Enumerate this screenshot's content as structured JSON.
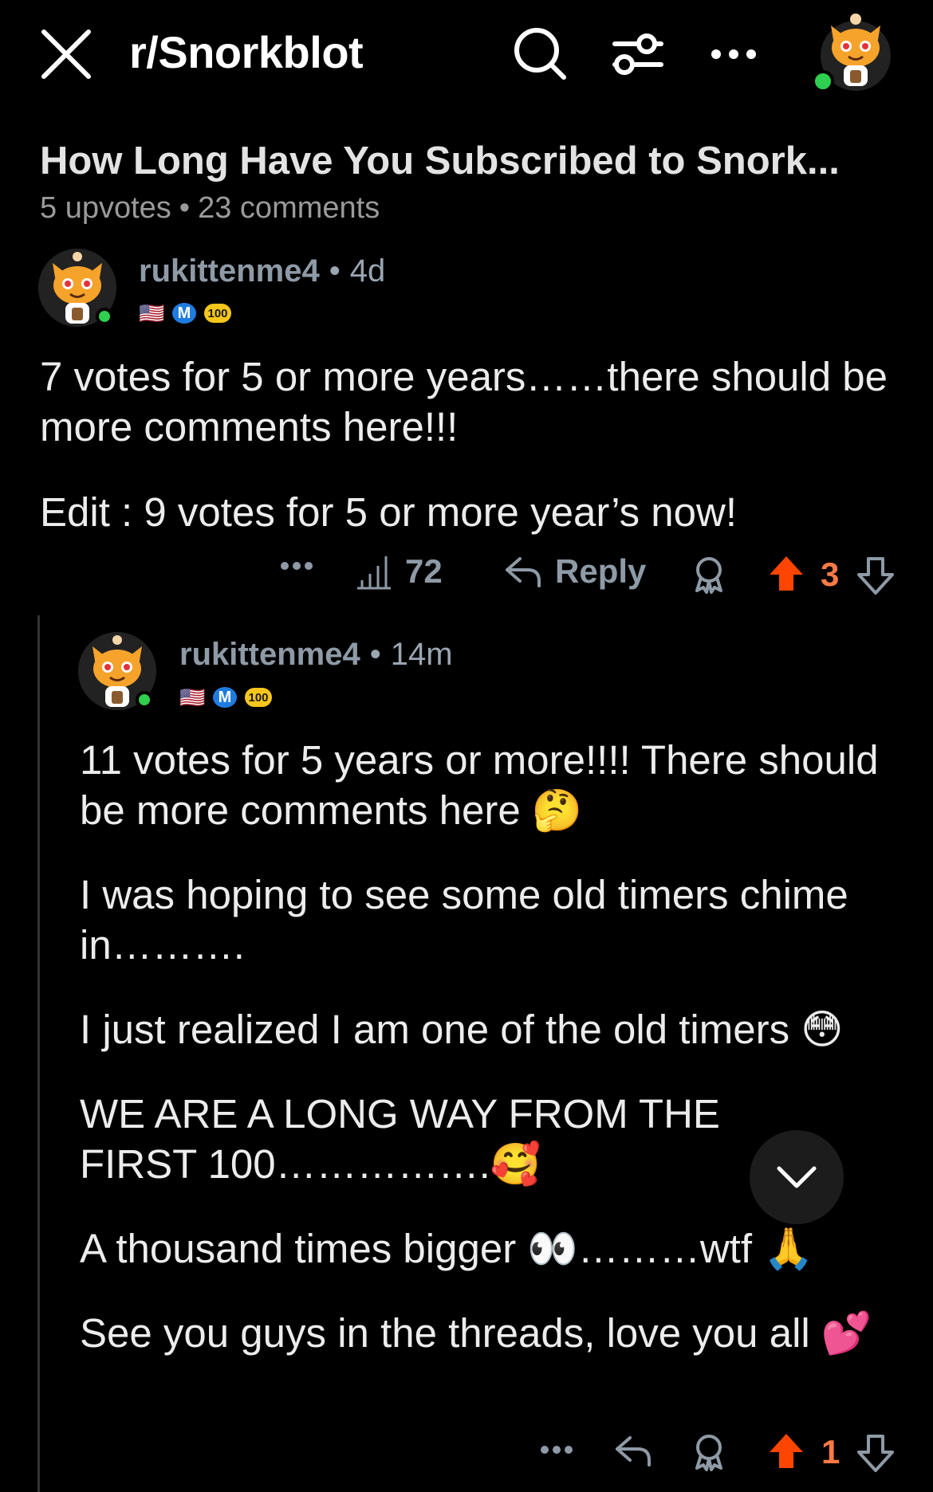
{
  "header": {
    "subreddit": "r/Snorkblot",
    "close_icon": "close-icon",
    "search_icon": "search-icon",
    "filter_icon": "filter-icon",
    "more_icon": "more-icon"
  },
  "post": {
    "title": "How Long Have You Subscribed to Snork...",
    "upvotes": "5 upvotes",
    "separator": "•",
    "comments": "23 comments"
  },
  "comments": [
    {
      "author": "rukittenme4",
      "separator": "•",
      "age": "4d",
      "flair": {
        "flag": "🇺🇸",
        "m_badge": "M",
        "hundred_badge": "100"
      },
      "paragraphs": [
        "7 votes for 5 or more years……there should be more comments here!!!",
        "Edit : 9 votes for 5 or more year’s now!"
      ],
      "actions": {
        "views": "72",
        "reply_label": "Reply",
        "score": "3"
      }
    },
    {
      "author": "rukittenme4",
      "separator": "•",
      "age": "14m",
      "flair": {
        "flag": "🇺🇸",
        "m_badge": "M",
        "hundred_badge": "100"
      },
      "paragraphs": [
        "11 votes for 5 years or more!!!! There should be more comments here 🤔",
        "I was hoping to see some old timers chime in……….",
        "I just realized I am one of the old timers 😳",
        "WE ARE A LONG WAY FROM THE FIRST 100…………….🥰",
        "A thousand times bigger 👀………wtf 🙏",
        "See you guys in the threads, love you all 💕"
      ],
      "actions": {
        "score": "1"
      }
    }
  ],
  "colors": {
    "upvote_active": "#ff4500",
    "score_active": "#ff7a45",
    "muted": "#8e9aa6",
    "online": "#2fcf4f"
  }
}
